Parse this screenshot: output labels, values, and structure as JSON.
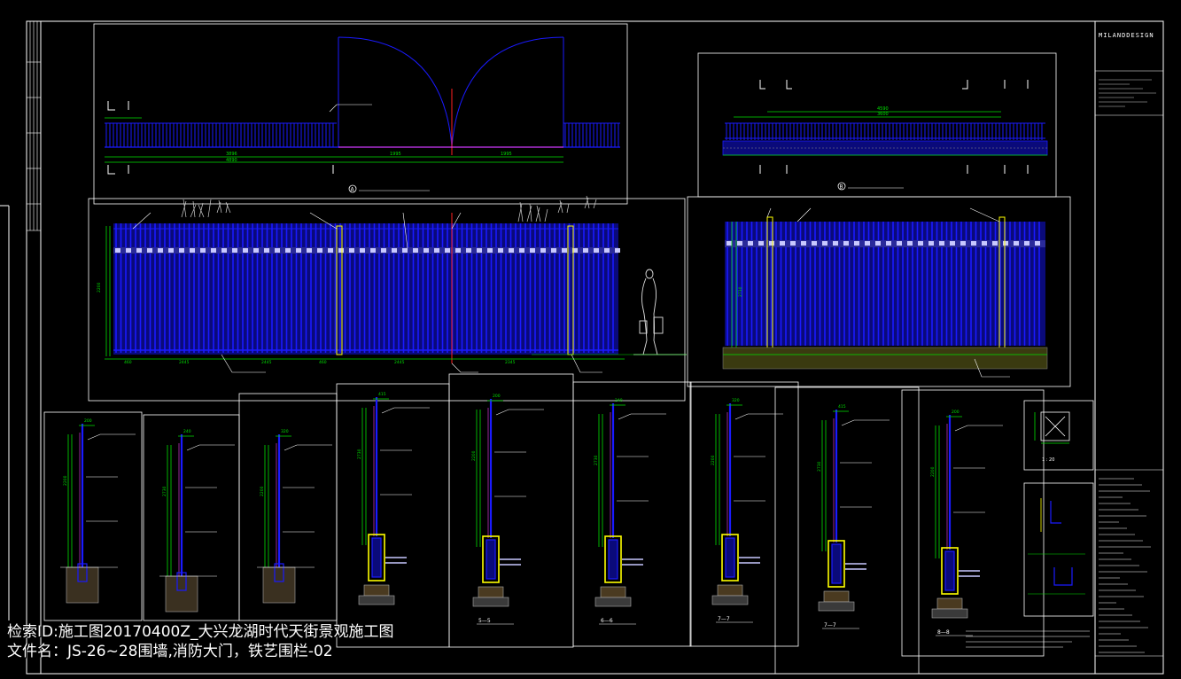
{
  "drawing": {
    "brand": "MILANDDESIGN",
    "elevations": [
      {
        "label": "A"
      },
      {
        "label": "B"
      }
    ],
    "dimensions_top_a": [
      "3896",
      "1995",
      "1995"
    ],
    "dimensions_top_a_total": "4890",
    "dimensions_top_b": [
      "4590",
      "3600"
    ],
    "dimensions_mid_a": [
      "460",
      "2445",
      "2445",
      "460",
      "2445",
      "2345"
    ],
    "dimensions_mid_a_height": "2200",
    "dimensions_mid_b_height": "2730",
    "sections": [
      {
        "label": "5—5"
      },
      {
        "label": "6—6"
      },
      {
        "label": "7—7"
      },
      {
        "label": "7—7"
      },
      {
        "label": "8—8"
      }
    ],
    "detail_label": "1 : 20",
    "section_dims": [
      "200",
      "240",
      "320",
      "415",
      "2200",
      "2730"
    ]
  },
  "captions": {
    "line1": "检索ID:施工图20170400Z_大兴龙湖时代天街景观施工图",
    "line2": "文件名：JS-26~28围墙,消防大门，铁艺围栏-02"
  },
  "colors": {
    "background": "#000000",
    "frame": "#ffffff",
    "fence": "#1a1aff",
    "fill": "#0a0a7a",
    "dimension": "#00e000",
    "leader": "#ffffff",
    "post": "#ffff00",
    "center": "#ff2020",
    "accent": "#ff40ff"
  }
}
